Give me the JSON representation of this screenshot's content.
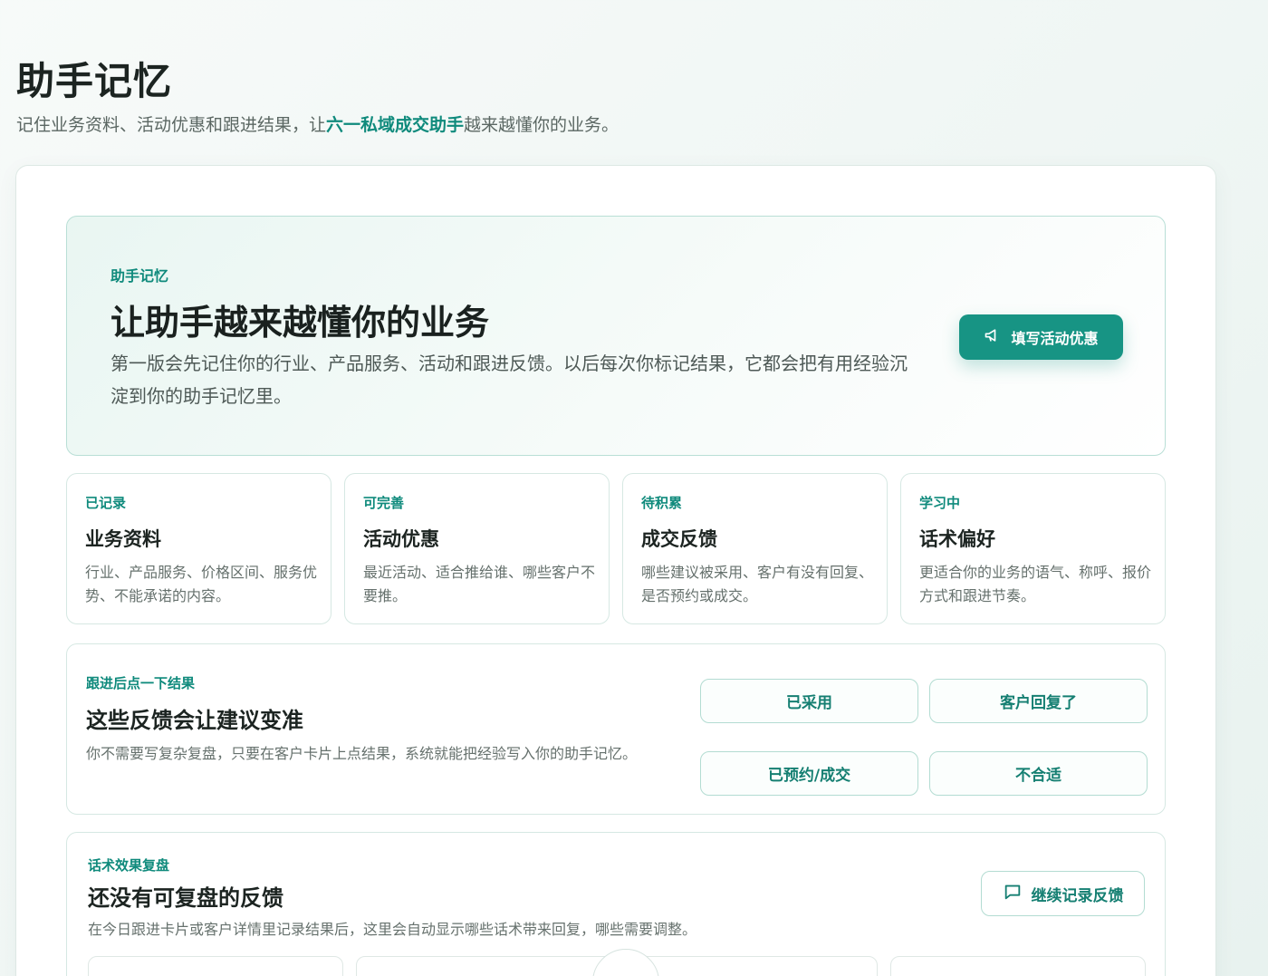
{
  "header": {
    "title": "助手记忆",
    "subtitle_prefix": "记住业务资料、活动优惠和跟进结果，让",
    "subtitle_brand": "六一私域成交助手",
    "subtitle_suffix": "越来越懂你的业务。"
  },
  "hero": {
    "eyebrow": "助手记忆",
    "title": "让助手越来越懂你的业务",
    "description": "第一版会先记住你的行业、产品服务、活动和跟进反馈。以后每次你标记结果，它都会把有用经验沉淀到你的助手记忆里。",
    "button_label": "填写活动优惠",
    "button_icon": "megaphone-icon"
  },
  "stats": [
    {
      "badge": "已记录",
      "title": "业务资料",
      "description": "行业、产品服务、价格区间、服务优势、不能承诺的内容。"
    },
    {
      "badge": "可完善",
      "title": "活动优惠",
      "description": "最近活动、适合推给谁、哪些客户不要推。"
    },
    {
      "badge": "待积累",
      "title": "成交反馈",
      "description": "哪些建议被采用、客户有没有回复、是否预约或成交。"
    },
    {
      "badge": "学习中",
      "title": "话术偏好",
      "description": "更适合你的业务的语气、称呼、报价方式和跟进节奏。"
    }
  ],
  "feedback": {
    "eyebrow": "跟进后点一下结果",
    "title": "这些反馈会让建议变准",
    "description": "你不需要写复杂复盘，只要在客户卡片上点结果，系统就能把经验写入你的助手记忆。",
    "options": [
      "已采用",
      "客户回复了",
      "已预约/成交",
      "不合适"
    ]
  },
  "review": {
    "eyebrow": "话术效果复盘",
    "title": "还没有可复盘的反馈",
    "description": "在今日跟进卡片或客户详情里记录结果后，这里会自动显示哪些话术带来回复，哪些需要调整。",
    "button_label": "继续记录反馈",
    "button_icon": "chat-bubble-icon"
  },
  "colors": {
    "accent": "#179484",
    "accent_text": "#0f8a7c",
    "border": "#d6e8e3"
  }
}
